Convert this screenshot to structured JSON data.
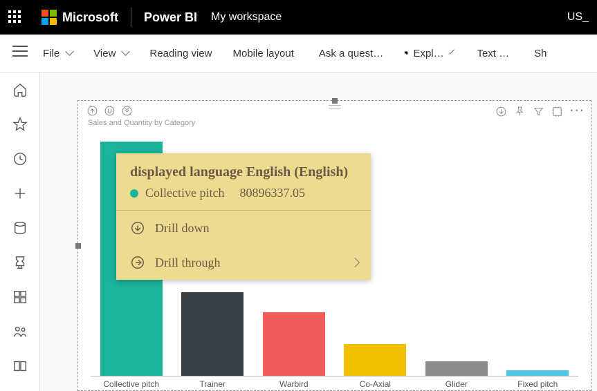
{
  "topbar": {
    "brand": "Microsoft",
    "app": "Power BI",
    "workspace": "My workspace",
    "lang": "US_"
  },
  "toolbar": {
    "file": "File",
    "view": "View",
    "reading": "Reading view",
    "mobile": "Mobile layout",
    "ask": "Ask a quest…",
    "explore": "Expl…",
    "textbox": "Text …",
    "shapes": "Sh"
  },
  "chart_data": {
    "type": "bar",
    "title": "Sales and Quantity by Category",
    "xlabel": "",
    "ylabel": "",
    "categories": [
      "Collective pitch",
      "Trainer",
      "Warbird",
      "Co-Axial",
      "Glider",
      "Fixed pitch"
    ],
    "values": [
      80896337.05,
      29000000,
      22000000,
      11000000,
      5000000,
      2000000
    ],
    "colors": [
      "#1cb39b",
      "#384045",
      "#f15b5b",
      "#f3c000",
      "#8c8c8c",
      "#4fc6e0"
    ],
    "ylim": [
      0,
      85000000
    ]
  },
  "tooltip": {
    "title": "displayed language English (English)",
    "series_name": "Collective pitch",
    "series_value": "80896337.05",
    "drilldown": "Drill down",
    "drillthrough": "Drill through"
  }
}
